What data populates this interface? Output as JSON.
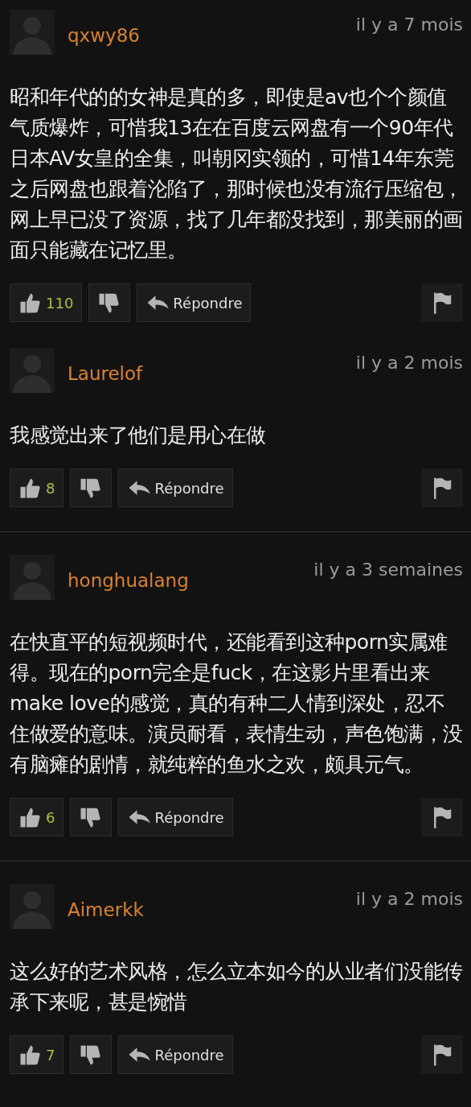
{
  "comments": [
    {
      "kind": "comment",
      "username": "qxwy86",
      "time": "il y a 7 mois",
      "text": "昭和年代的的女神是真的多，即使是av也个个颜值气质爆炸，可惜我13在在百度云网盘有一个90年代日本AV女皇的全集，叫朝冈实领的，可惜14年东莞之后网盘也跟着沦陷了，那时候也没有流行压缩包，网上早已没了资源，找了几年都没找到，那美丽的画面只能藏在记忆里。",
      "likes": "110",
      "reply": "Répondre"
    },
    {
      "kind": "comment",
      "username": "Laurelof",
      "time": "il y a 2 mois",
      "text": "我感觉出来了他们是用心在做",
      "likes": "8",
      "reply": "Répondre"
    },
    {
      "kind": "divider"
    },
    {
      "kind": "comment",
      "username": "honghualang",
      "time": "il y a 3 semaines",
      "text": "在快直平的短视频时代，还能看到这种porn实属难得。现在的porn完全是fuck，在这影片里看出来make love的感觉，真的有种二人情到深处，忍不住做爱的意味。演员耐看，表情生动，声色饱满，没有脑瘫的剧情，就纯粹的鱼水之欢，颇具元气。",
      "likes": "6",
      "reply": "Répondre"
    },
    {
      "kind": "divider"
    },
    {
      "kind": "comment",
      "username": "Aimerkk",
      "time": "il y a 2 mois",
      "text": "这么好的艺术风格，怎么立本如今的从业者们没能传承下来呢，甚是惋惜",
      "likes": "7",
      "reply": "Répondre"
    }
  ]
}
